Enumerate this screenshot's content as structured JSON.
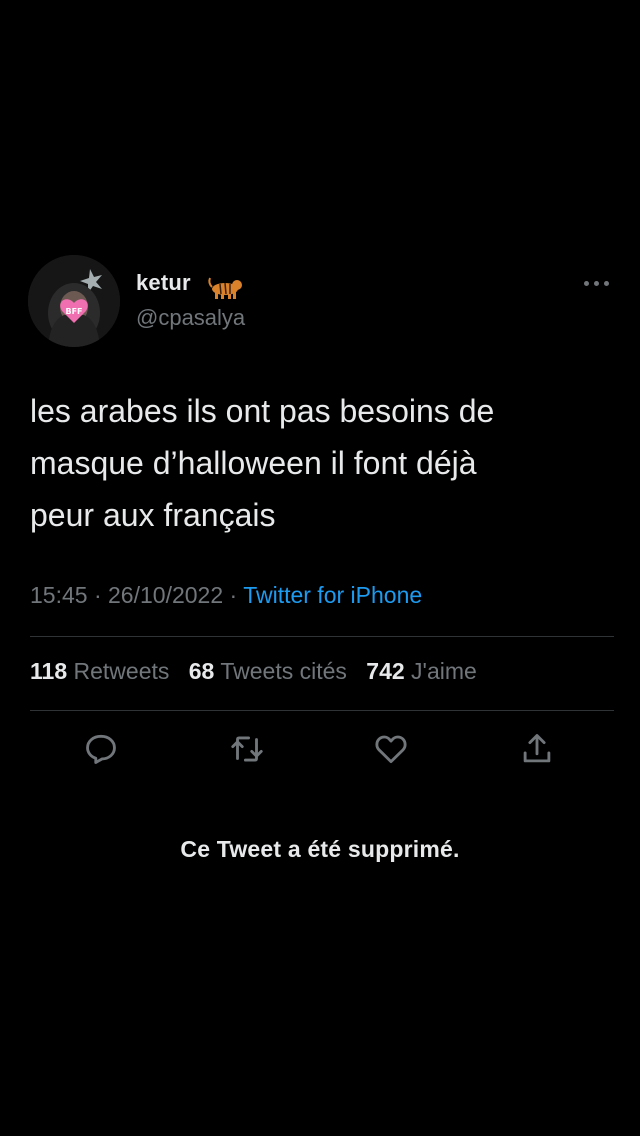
{
  "tweet": {
    "author": {
      "display_name": "ketur",
      "name_emoji": "tiger-emoji",
      "handle": "@cpasalya",
      "avatar": "avatar-icon"
    },
    "text": "les arabes ils ont pas besoins de\nmasque d’halloween il font déjà\npeur aux français",
    "time": "15:45",
    "separator": "·",
    "date": "26/10/2022",
    "source": "Twitter for iPhone",
    "stats": {
      "retweets_count": "118",
      "retweets_label": "Retweets",
      "quotes_count": "68",
      "quotes_label": "Tweets cités",
      "likes_count": "742",
      "likes_label": "J'aime"
    },
    "actions": [
      "reply-icon",
      "retweet-icon",
      "like-icon",
      "share-icon"
    ],
    "more_icon": "more-dots-icon"
  },
  "notice": {
    "deleted_text": "Ce Tweet a été supprimé."
  },
  "colors": {
    "background": "#000000",
    "text_primary": "#e7e9ea",
    "text_secondary": "#71767b",
    "accent": "#1d9bf0",
    "divider": "#2f3336"
  }
}
